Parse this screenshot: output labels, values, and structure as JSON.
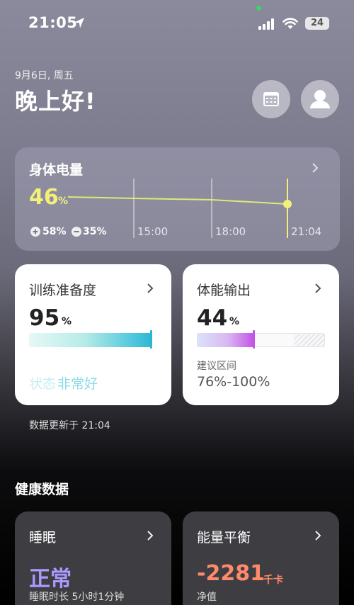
{
  "status_bar": {
    "time": "21:05",
    "battery": "24"
  },
  "header": {
    "date": "9月6日, 周五",
    "greeting": "晚上好!"
  },
  "body_battery": {
    "title": "身体电量",
    "value": "46",
    "unit": "%",
    "gain": "58%",
    "loss": "35%",
    "times": [
      "15:00",
      "18:00",
      "21:04"
    ]
  },
  "readiness": {
    "title": "训练准备度",
    "value": "95",
    "unit": "%",
    "status_prefix": "状态",
    "status_main": "非常好"
  },
  "output": {
    "title": "体能输出",
    "value": "44",
    "unit": "%",
    "range_label": "建议区间",
    "range_value": "76%-100%"
  },
  "updated_text": "数据更新于 21:04",
  "health_section": {
    "title": "健康数据"
  },
  "sleep": {
    "title": "睡眠",
    "value": "正常",
    "detail": "睡眠时长 5小时1分钟"
  },
  "energy": {
    "title": "能量平衡",
    "value": "-2281",
    "unit": "千卡",
    "sub": "净值"
  },
  "colors": {
    "battery_yellow": "#f3f07a",
    "sleep_purple": "#a99bff",
    "energy_orange": "#ff8a6a",
    "teal": "#2bb6d1",
    "magenta": "#c454e6"
  }
}
